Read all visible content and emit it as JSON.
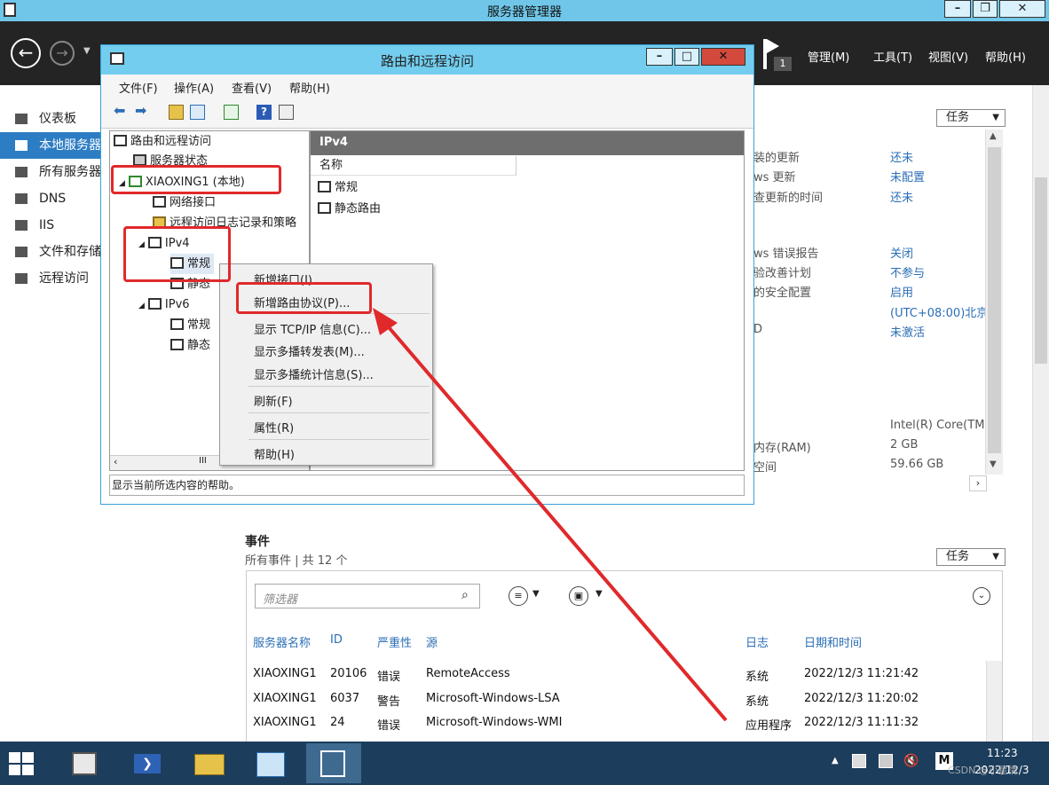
{
  "outer": {
    "title": "服务器管理器",
    "menus": [
      "管理(M)",
      "工具(T)",
      "视图(V)",
      "帮助(H)"
    ],
    "flag_count": "1",
    "nav": [
      "仪表板",
      "本地服务器",
      "所有服务器",
      "DNS",
      "IIS",
      "文件和存储服务",
      "远程访问"
    ],
    "tasks_label": "任务",
    "properties": [
      {
        "label": "装的更新",
        "value": "还未"
      },
      {
        "label": "ws 更新",
        "value": "未配置"
      },
      {
        "label": "查更新的时间",
        "value": "还未"
      },
      {
        "label": "ws 错误报告",
        "value": "关闭"
      },
      {
        "label": "验改善计划",
        "value": "不参与"
      },
      {
        "label": "的安全配置",
        "value": "启用"
      },
      {
        "label": "",
        "value": "(UTC+08:00)北京"
      },
      {
        "label": "D",
        "value": "未激活"
      },
      {
        "label": "",
        "value": "Intel(R) Core(TM"
      },
      {
        "label": "内存(RAM)",
        "value": "2 GB"
      },
      {
        "label": "空间",
        "value": "59.66 GB"
      }
    ]
  },
  "events": {
    "title": "事件",
    "subtitle": "所有事件 | 共 12 个",
    "tasks_label": "任务",
    "filter_placeholder": "筛选器",
    "columns": [
      "服务器名称",
      "ID",
      "严重性",
      "源",
      "日志",
      "日期和时间"
    ],
    "rows": [
      [
        "XIAOXING1",
        "20106",
        "错误",
        "RemoteAccess",
        "系统",
        "2022/12/3 11:21:42"
      ],
      [
        "XIAOXING1",
        "6037",
        "警告",
        "Microsoft-Windows-LSA",
        "系统",
        "2022/12/3 11:20:02"
      ],
      [
        "XIAOXING1",
        "24",
        "错误",
        "Microsoft-Windows-WMI",
        "应用程序",
        "2022/12/3 11:11:32"
      ]
    ]
  },
  "rras": {
    "title": "路由和远程访问",
    "menu": [
      "文件(F)",
      "操作(A)",
      "查看(V)",
      "帮助(H)"
    ],
    "tree": {
      "root": "路由和远程访问",
      "server_status": "服务器状态",
      "server": "XIAOXING1 (本地)",
      "net_if": "网络接口",
      "log_policy": "远程访问日志记录和策略",
      "ipv4": "IPv4",
      "ipv4_general": "常规",
      "ipv4_static": "静态",
      "ipv6": "IPv6",
      "ipv6_general": "常规",
      "ipv6_static": "静态"
    },
    "pane_header": "IPv4",
    "pane_column": "名称",
    "pane_items": [
      "常规",
      "静态路由"
    ],
    "status": "显示当前所选内容的帮助。"
  },
  "context_menu": {
    "items": [
      "新增接口(I)...",
      "新增路由协议(P)...",
      "显示 TCP/IP 信息(C)...",
      "显示多播转发表(M)...",
      "显示多播统计信息(S)...",
      "刷新(F)",
      "属性(R)",
      "帮助(H)"
    ]
  },
  "taskbar": {
    "time": "11:23",
    "date": "2022/12/3",
    "watermark": "CSDN @小星情"
  }
}
